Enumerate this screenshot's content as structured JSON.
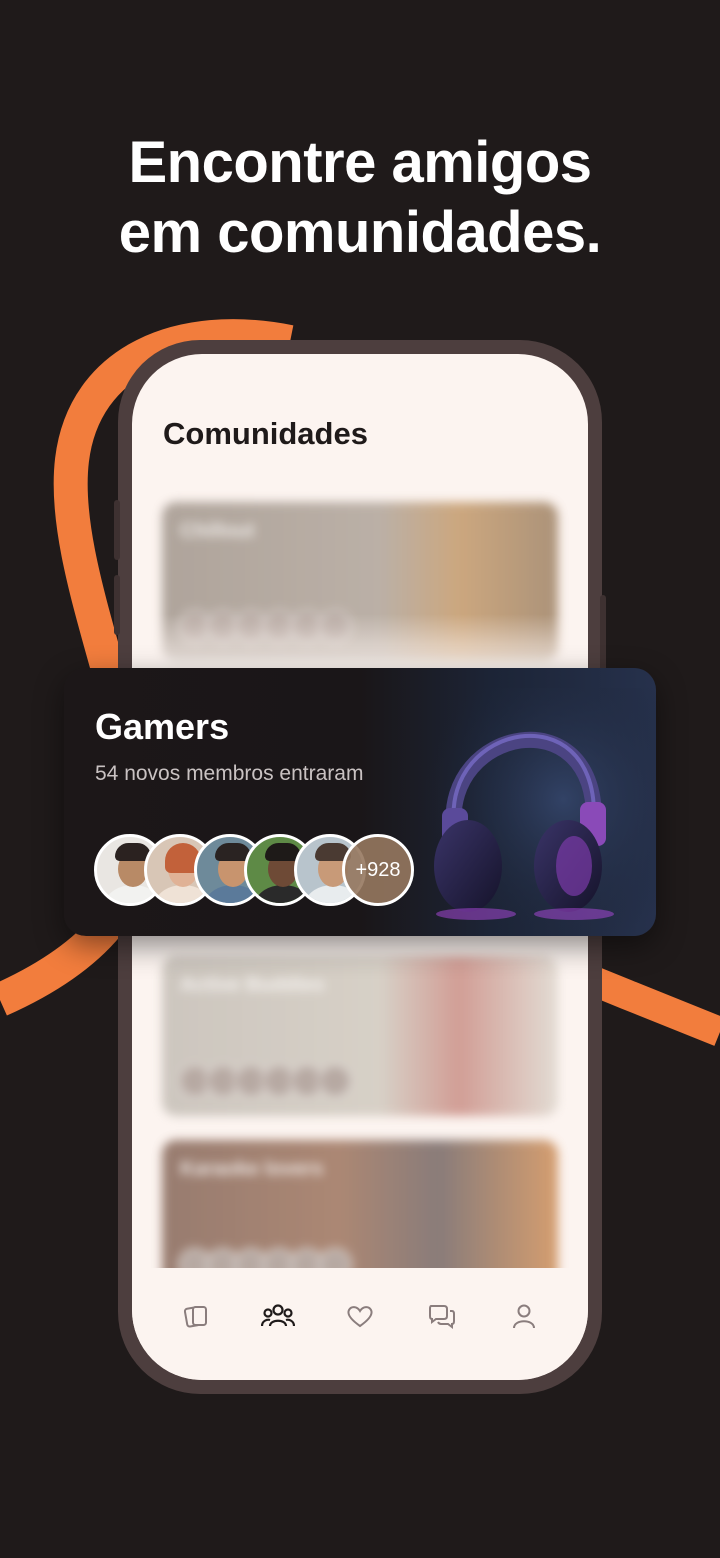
{
  "headline": {
    "line1": "Encontre amigos",
    "line2": "em comunidades."
  },
  "colors": {
    "background": "#1f1a1a",
    "accent": "#f27d3d",
    "screen": "#fcf4f0",
    "phone_frame": "#4d3e3e"
  },
  "screen": {
    "title": "Comunidades"
  },
  "featured_card": {
    "title": "Gamers",
    "subtitle": "54 novos membros entraram",
    "more_members": "+928",
    "image": "headphones"
  },
  "blurred_cards": [
    {
      "title": "Chillout"
    },
    {
      "title": "Active Buddies"
    },
    {
      "title": "Karaoke lovers"
    }
  ],
  "tabbar": {
    "items": [
      {
        "icon": "cards-icon",
        "active": false
      },
      {
        "icon": "communities-icon",
        "active": true
      },
      {
        "icon": "heart-icon",
        "active": false
      },
      {
        "icon": "chat-icon",
        "active": false
      },
      {
        "icon": "profile-icon",
        "active": false
      }
    ]
  }
}
